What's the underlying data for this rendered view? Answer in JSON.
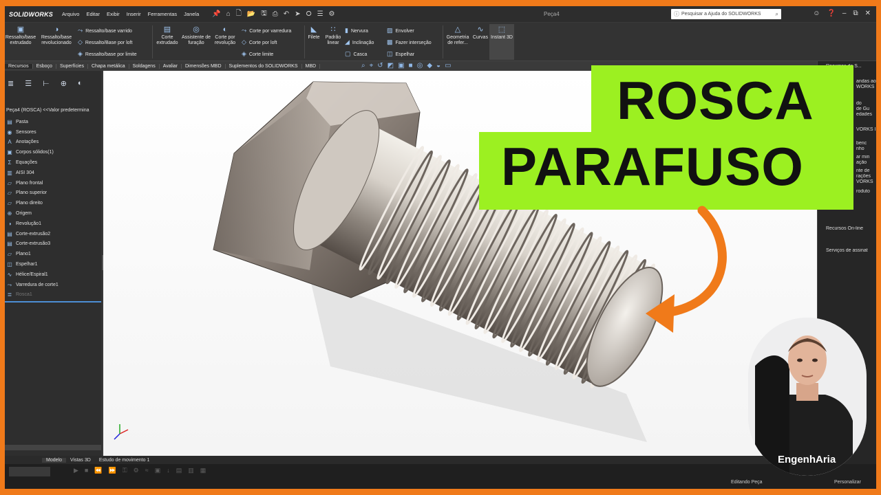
{
  "app": {
    "logo": "SOLIDWORKS",
    "document_title": "Peça4"
  },
  "menu": [
    "Arquivo",
    "Editar",
    "Exibir",
    "Inserir",
    "Ferramentas",
    "Janela"
  ],
  "help_search": {
    "placeholder": "Pesquisar a Ajuda do SOLIDWORKS"
  },
  "ribbon": {
    "boss_extrude": "Ressalto/base extrudado",
    "boss_revolve": "Ressalto/base revolucionado",
    "swept_boss": "Ressalto/base varrido",
    "loft_boss": "Ressalto/Base por loft",
    "boundary_boss": "Ressalto/base por limite",
    "cut_extrude": "Corte extrudado",
    "hole_wizard": "Assistente de furação",
    "cut_revolve": "Corte por revolução",
    "swept_cut": "Corte por varredura",
    "loft_cut": "Corte por loft",
    "boundary_cut": "Corte limite",
    "fillet": "Filete",
    "linear_pattern": "Padrão linear",
    "rib": "Nervura",
    "draft": "Inclinação",
    "shell": "Casca",
    "wrap": "Envolver",
    "intersect": "Fazer interseção",
    "mirror": "Espelhar",
    "ref_geometry": "Geometria de refer...",
    "curves": "Curvas",
    "instant3d": "Instant 3D"
  },
  "tabs": [
    "Recursos",
    "Esboço",
    "Superfícies",
    "Chapa metálica",
    "Soldagens",
    "Avaliar",
    "Dimensões MBD",
    "Suplementos do SOLIDWORKS",
    "MBD"
  ],
  "tree": {
    "root": "Peça4 (ROSCA) <<Valor predetermina",
    "items": [
      {
        "label": "Pasta",
        "icon": "folder-icon"
      },
      {
        "label": "Sensores",
        "icon": "sensor-icon"
      },
      {
        "label": "Anotações",
        "icon": "annotation-icon"
      },
      {
        "label": "Corpos sólidos(1)",
        "icon": "solid-bodies-icon"
      },
      {
        "label": "Equações",
        "icon": "equation-icon"
      },
      {
        "label": "AISI 304",
        "icon": "material-icon"
      },
      {
        "label": "Plano frontal",
        "icon": "plane-icon"
      },
      {
        "label": "Plano superior",
        "icon": "plane-icon"
      },
      {
        "label": "Plano direito",
        "icon": "plane-icon"
      },
      {
        "label": "Origem",
        "icon": "origin-icon"
      },
      {
        "label": "Revolução1",
        "icon": "revolve-icon"
      },
      {
        "label": "Corte-extrusão2",
        "icon": "cut-extrude-icon"
      },
      {
        "label": "Corte-extrusão3",
        "icon": "cut-extrude-icon"
      },
      {
        "label": "Plano1",
        "icon": "plane-icon"
      },
      {
        "label": "Espelhar1",
        "icon": "mirror-icon"
      },
      {
        "label": "Hélice/Espiral1",
        "icon": "helix-icon"
      },
      {
        "label": "Varredura de corte1",
        "icon": "swept-cut-icon"
      },
      {
        "label": "Rosca1",
        "icon": "thread-icon",
        "suppressed": true
      }
    ]
  },
  "taskpane": {
    "header": "Recursos do S...",
    "lines": [
      "andas ao",
      "WORKS",
      "do",
      "de Gu",
      "edades",
      "VORKS I",
      "benc",
      "nho",
      "ar min",
      "ação",
      "nte de",
      "rações",
      "VORKS",
      "roduto"
    ],
    "online_resources": "Recursos On-line",
    "subscription": "Serviços de assinat"
  },
  "bottom_tabs": [
    "Modelo",
    "Vistas 3D",
    "Estudo de movimento 1"
  ],
  "status": {
    "editing": "Editando Peça",
    "custom": "Personalizar"
  },
  "overlay": {
    "title_line1": "ROSCA",
    "title_line2": "PARAFUSO",
    "brand": "EngenhAria",
    "accent_green": "#9cf021",
    "accent_orange": "#f07a1a"
  }
}
